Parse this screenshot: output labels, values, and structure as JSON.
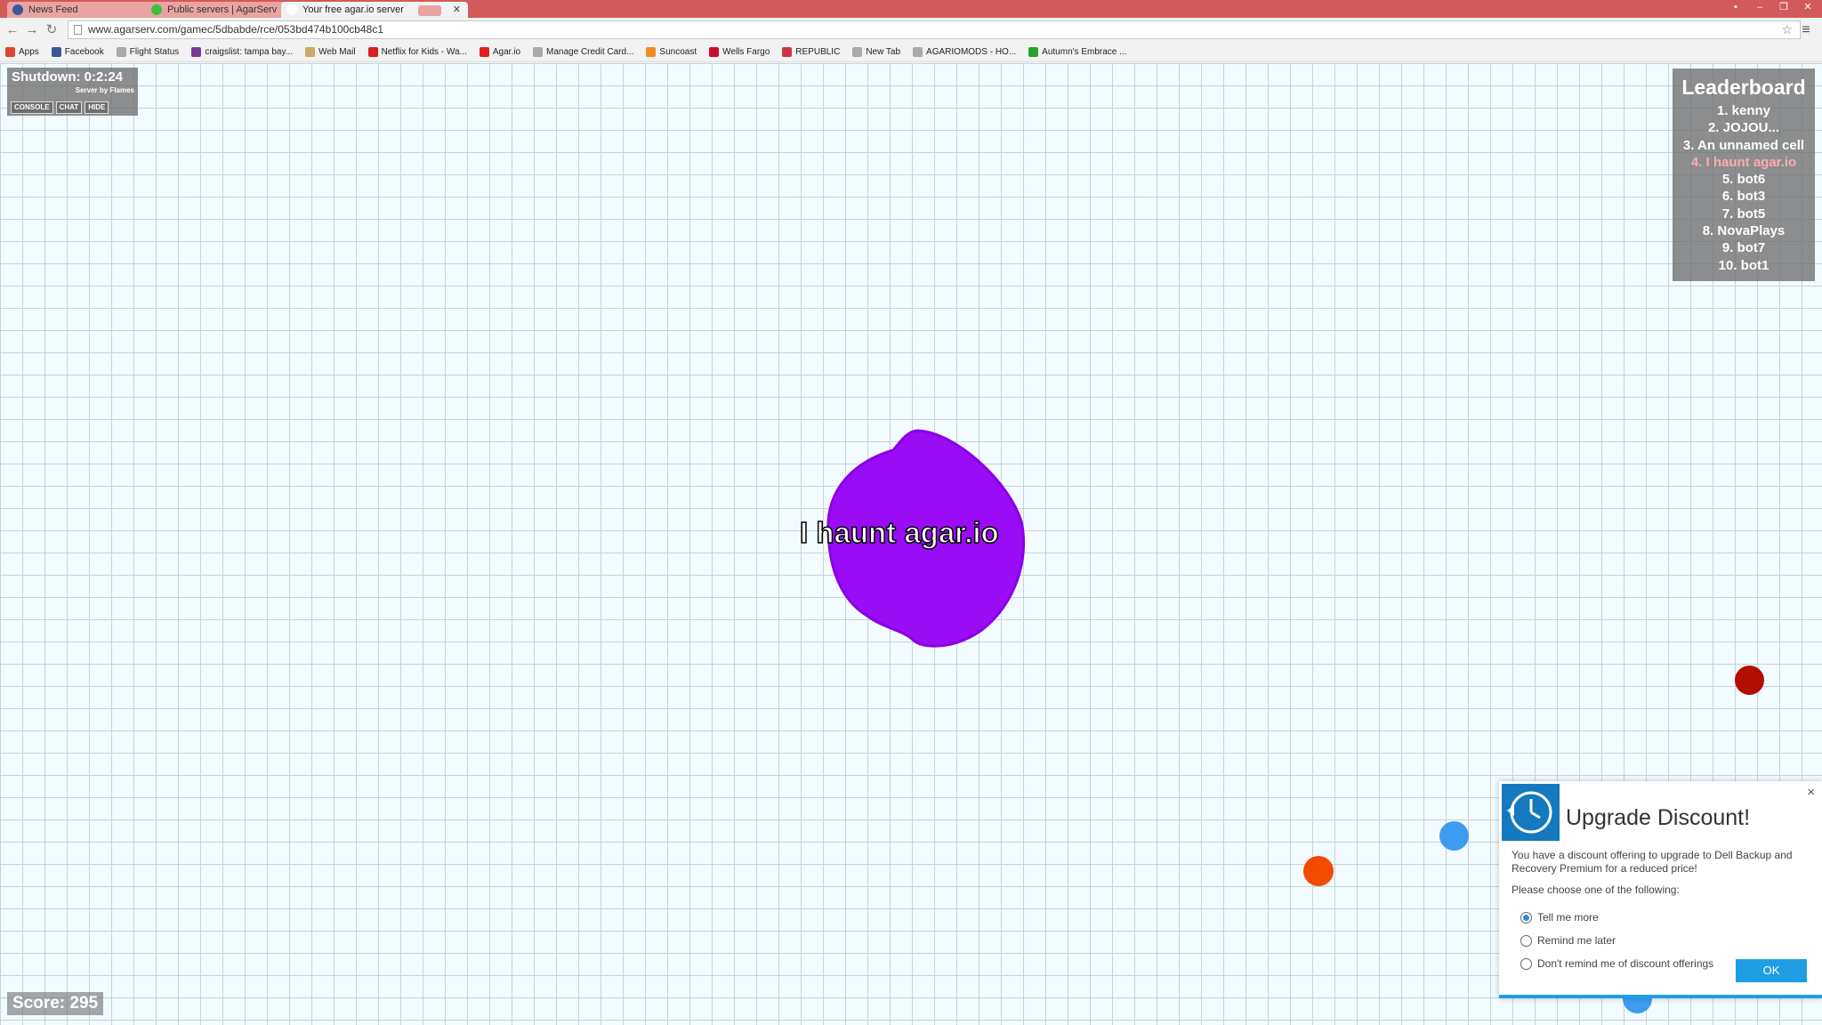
{
  "browser": {
    "tabs": [
      {
        "title": "News Feed",
        "icon_color": "#3b5998"
      },
      {
        "title": "Public servers | AgarServ",
        "icon_color": "#3cc13c"
      },
      {
        "title": "Your free agar.io server",
        "icon_color": "#ffffff"
      }
    ],
    "url": "www.agarserv.com/gamec/5dbabde/rce/053bd474b100cb48c1",
    "bookmarks": [
      {
        "label": "Apps",
        "icon_color": "#e0452d"
      },
      {
        "label": "Facebook",
        "icon_color": "#3b5998"
      },
      {
        "label": "Flight Status",
        "icon_color": "#aaaaaa"
      },
      {
        "label": "craigslist: tampa bay...",
        "icon_color": "#7a3a9a"
      },
      {
        "label": "Web Mail",
        "icon_color": "#ccaa66"
      },
      {
        "label": "Netflix for Kids - Wa...",
        "icon_color": "#d81f26"
      },
      {
        "label": "Agar.io",
        "icon_color": "#e02020"
      },
      {
        "label": "Manage Credit Card...",
        "icon_color": "#aaaaaa"
      },
      {
        "label": "Suncoast",
        "icon_color": "#f08c1e"
      },
      {
        "label": "Wells Fargo",
        "icon_color": "#c8102e"
      },
      {
        "label": "REPUBLIC",
        "icon_color": "#cc3344"
      },
      {
        "label": "New Tab",
        "icon_color": "#aaaaaa"
      },
      {
        "label": "AGARIOMODS - HO...",
        "icon_color": "#aaaaaa"
      },
      {
        "label": "Autumn's Embrace ...",
        "icon_color": "#2aa02a"
      }
    ]
  },
  "game": {
    "status": {
      "title": "Shutdown: 0:2:24",
      "subtitle": "Server by Flames",
      "buttons": [
        "CONSOLE",
        "CHAT",
        "HIDE"
      ]
    },
    "leaderboard": {
      "title": "Leaderboard",
      "entries": [
        "1. kenny",
        "2. JOJOU...",
        "3. An unnamed cell",
        "4. I haunt agar.io",
        "5. bot6",
        "6. bot3",
        "7. bot5",
        "8. NovaPlays",
        "9. bot7",
        "10. bot1"
      ],
      "highlight_color": "#ffaaaa"
    },
    "player": {
      "name": "I haunt agar.io",
      "color": "#9a0cf5"
    },
    "pellets": [
      {
        "name": "pellet-dark-red",
        "color": "#b30f00"
      },
      {
        "name": "pellet-blue",
        "color": "#3d9cf0"
      },
      {
        "name": "pellet-orange",
        "color": "#f24a00"
      },
      {
        "name": "pellet-blue-partial",
        "color": "#3d9cf0"
      }
    ],
    "score": "Score: 295"
  },
  "popup": {
    "title": "Upgrade Discount!",
    "description": "You have a discount offering to upgrade to Dell Backup and Recovery Premium for a reduced price!",
    "choose_label": "Please choose one of the following:",
    "options": [
      "Tell me more",
      "Remind me later",
      "Don't remind me of discount offerings"
    ],
    "selected_option": "Tell me more",
    "ok_label": "OK",
    "close_label": "×",
    "accent_color": "#1f9ee3"
  }
}
